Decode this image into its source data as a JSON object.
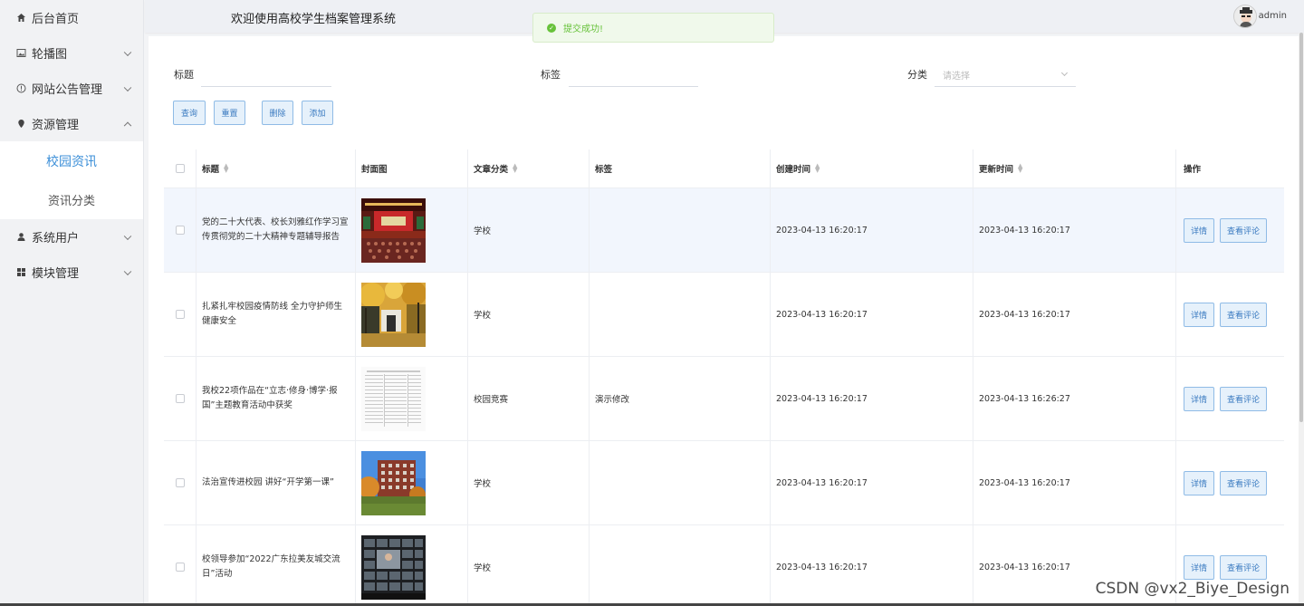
{
  "sidebar": {
    "items": [
      {
        "label": "后台首页",
        "icon": "home-icon",
        "expanded": null
      },
      {
        "label": "轮播图",
        "icon": "image-icon",
        "expanded": false
      },
      {
        "label": "网站公告管理",
        "icon": "info-icon",
        "expanded": false
      },
      {
        "label": "资源管理",
        "icon": "pin-icon",
        "expanded": true,
        "children": [
          {
            "label": "校园资讯",
            "active": true
          },
          {
            "label": "资讯分类",
            "active": false
          }
        ]
      },
      {
        "label": "系统用户",
        "icon": "user-icon",
        "expanded": false
      },
      {
        "label": "模块管理",
        "icon": "grid-icon",
        "expanded": false
      }
    ]
  },
  "header": {
    "title": "欢迎使用高校学生档案管理系统",
    "username": "admin"
  },
  "toast": {
    "message": "提交成功!",
    "type": "success"
  },
  "search": {
    "title_label": "标题",
    "tag_label": "标签",
    "category_label": "分类",
    "category_placeholder": "请选择"
  },
  "toolbar": {
    "query_label": "查询",
    "reset_label": "重置",
    "delete_label": "删除",
    "add_label": "添加"
  },
  "table": {
    "columns": {
      "title": "标题",
      "cover": "封面图",
      "category": "文章分类",
      "tag": "标签",
      "created": "创建时间",
      "updated": "更新时间",
      "actions": "操作"
    },
    "detail_label": "详情",
    "comment_label": "查看评论",
    "rows": [
      {
        "title": "党的二十大代表、校长刘雅红作学习宣传贯彻党的二十大精神专题辅导报告",
        "category": "学校",
        "tag": "",
        "created": "2023-04-13 16:20:17",
        "updated": "2023-04-13 16:20:17",
        "cover": "auditorium"
      },
      {
        "title": "扎紧扎牢校园疫情防线 全力守护师生健康安全",
        "category": "学校",
        "tag": "",
        "created": "2023-04-13 16:20:17",
        "updated": "2023-04-13 16:20:17",
        "cover": "autumn-trees"
      },
      {
        "title": "我校22项作品在“立志·修身·博学·报国”主题教育活动中获奖",
        "category": "校园竞赛",
        "tag": "演示修改",
        "created": "2023-04-13 16:20:17",
        "updated": "2023-04-13 16:26:27",
        "cover": "document"
      },
      {
        "title": "法治宣传进校园 讲好“开学第一课”",
        "category": "学校",
        "tag": "",
        "created": "2023-04-13 16:20:17",
        "updated": "2023-04-13 16:20:17",
        "cover": "building"
      },
      {
        "title": "校领导参加“2022广东拉美友城交流日”活动",
        "category": "学校",
        "tag": "",
        "created": "2023-04-13 16:20:17",
        "updated": "2023-04-13 16:20:17",
        "cover": "video-call"
      }
    ]
  },
  "watermark": "CSDN @vx2_Biye_Design",
  "colors": {
    "accent": "#3c8fd8",
    "success": "#67c23a",
    "button_bg": "#e6f1fb",
    "button_border": "#8fbbe6"
  }
}
